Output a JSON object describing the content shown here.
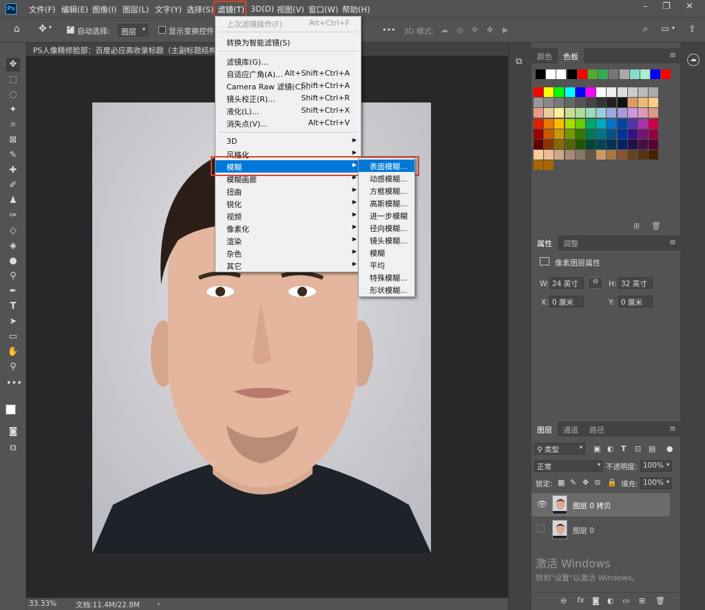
{
  "menubar": {
    "logo": "Ps",
    "items": [
      "文件(F)",
      "编辑(E)",
      "图像(I)",
      "图层(L)",
      "文字(Y)",
      "选择(S)",
      "滤镜(T)",
      "3D(D)",
      "视图(V)",
      "窗口(W)",
      "帮助(H)"
    ]
  },
  "options": {
    "auto_select_label": "自动选择:",
    "auto_select_value": "图层",
    "show_transform_label": "显示变换控件",
    "mode_3d_label": "3D 模式:"
  },
  "doc": {
    "tab_title": "PS人像精修脸部：百度必应高收录标题（主副标题结构"
  },
  "status": {
    "zoom": "33.33%",
    "doc_size": "文档:11.4M/22.8M"
  },
  "filter_menu": {
    "last_filter": "上次滤镜操作(F)",
    "last_filter_shortcut": "Alt+Ctrl+F",
    "smart": "转换为智能滤镜(S)",
    "gallery": "滤镜库(G)...",
    "adaptive_wide": "自适应广角(A)...",
    "adaptive_wide_shortcut": "Alt+Shift+Ctrl+A",
    "camera_raw": "Camera Raw 滤镜(C)...",
    "camera_raw_shortcut": "Shift+Ctrl+A",
    "lens": "镜头校正(R)...",
    "lens_shortcut": "Shift+Ctrl+R",
    "liquify": "液化(L)...",
    "liquify_shortcut": "Shift+Ctrl+X",
    "vanishing": "消失点(V)...",
    "vanishing_shortcut": "Alt+Ctrl+V",
    "groups": [
      "3D",
      "风格化",
      "模糊",
      "模糊画廊",
      "扭曲",
      "锐化",
      "视频",
      "像素化",
      "渲染",
      "杂色",
      "其它"
    ]
  },
  "blur_submenu": [
    "表面模糊...",
    "动感模糊...",
    "方框模糊...",
    "高斯模糊...",
    "进一步模糊",
    "径向模糊...",
    "镜头模糊...",
    "模糊",
    "平均",
    "特殊模糊...",
    "形状模糊..."
  ],
  "swatches_panel": {
    "tabs": [
      "颜色",
      "色板"
    ]
  },
  "properties_panel": {
    "tabs": [
      "属性",
      "调整"
    ],
    "title": "像素图层属性",
    "w_label": "W:",
    "w_value": "24 英寸",
    "h_label": "H:",
    "h_value": "32 英寸",
    "x_label": "X:",
    "x_value": "0 厘米",
    "y_label": "Y:",
    "y_value": "0 厘米"
  },
  "layers_panel": {
    "tabs": [
      "图层",
      "通道",
      "路径"
    ],
    "filter_kind": "类型",
    "blend_mode": "正常",
    "opacity_label": "不透明度:",
    "opacity_value": "100%",
    "lock_label": "锁定:",
    "fill_label": "填充:",
    "fill_value": "100%",
    "layers": [
      {
        "name": "图层 0 拷贝"
      },
      {
        "name": "图层 0"
      }
    ]
  },
  "watermark": {
    "title": "激活 Windows",
    "subtitle": "转到\"设置\"以激活 Windows。"
  },
  "colors": {
    "accent": "#0078d7",
    "highlight_box": "#d9432b",
    "ui_bg": "#535353"
  }
}
